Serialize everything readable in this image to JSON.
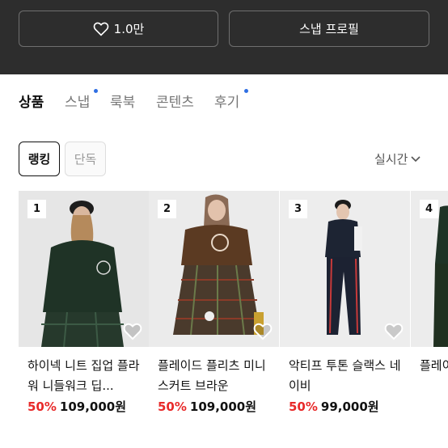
{
  "header": {
    "like_count": "1.0만",
    "snap_profile_label": "스냅 프로필"
  },
  "tabs": [
    {
      "label": "상품",
      "active": true,
      "new": false
    },
    {
      "label": "스냅",
      "active": false,
      "new": true
    },
    {
      "label": "룩북",
      "active": false,
      "new": false
    },
    {
      "label": "콘텐츠",
      "active": false,
      "new": false
    },
    {
      "label": "후기",
      "active": false,
      "new": true
    }
  ],
  "filters": {
    "ranking_label": "랭킹",
    "solo_label": "단독",
    "sort_label": "실시간"
  },
  "products": [
    {
      "rank": "1",
      "title": "하이넥 니트 집업 플라워 니들워크 딥...",
      "discount": "50%",
      "price": "109,000원"
    },
    {
      "rank": "2",
      "title": "플레이드 플리츠 미니 스커트 브라운",
      "discount": "50%",
      "price": "109,000원"
    },
    {
      "rank": "3",
      "title": "악티프 투톤 슬랙스 네이비",
      "discount": "50%",
      "price": "99,000원"
    },
    {
      "rank": "4",
      "title": "플레이 니 스",
      "discount": "",
      "price": ""
    }
  ],
  "colors": {
    "header_bg": "#2d2d2d",
    "discount": "#e82a2a",
    "new_dot": "#2f6fe3"
  }
}
